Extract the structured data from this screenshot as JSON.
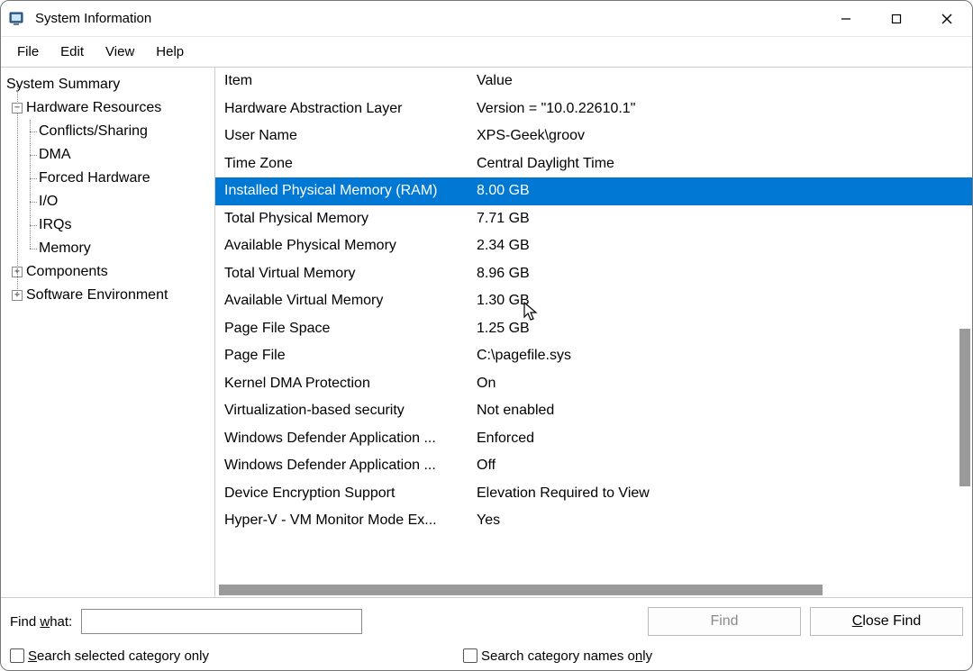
{
  "window": {
    "title": "System Information"
  },
  "menu": {
    "file": "File",
    "edit": "Edit",
    "view": "View",
    "help": "Help"
  },
  "tree": {
    "root": "System Summary",
    "hardware": "Hardware Resources",
    "hw_children": {
      "conflicts": "Conflicts/Sharing",
      "dma": "DMA",
      "forced": "Forced Hardware",
      "io": "I/O",
      "irqs": "IRQs",
      "memory": "Memory"
    },
    "components": "Components",
    "software": "Software Environment"
  },
  "columns": {
    "item": "Item",
    "value": "Value"
  },
  "rows": [
    {
      "item": "Hardware Abstraction Layer",
      "value": "Version = \"10.0.22610.1\""
    },
    {
      "item": "User Name",
      "value": "XPS-Geek\\groov"
    },
    {
      "item": "Time Zone",
      "value": "Central Daylight Time"
    },
    {
      "item": "Installed Physical Memory (RAM)",
      "value": "8.00 GB",
      "selected": true
    },
    {
      "item": "Total Physical Memory",
      "value": "7.71 GB"
    },
    {
      "item": "Available Physical Memory",
      "value": "2.34 GB"
    },
    {
      "item": "Total Virtual Memory",
      "value": "8.96 GB"
    },
    {
      "item": "Available Virtual Memory",
      "value": "1.30 GB"
    },
    {
      "item": "Page File Space",
      "value": "1.25 GB"
    },
    {
      "item": "Page File",
      "value": "C:\\pagefile.sys"
    },
    {
      "item": "Kernel DMA Protection",
      "value": "On"
    },
    {
      "item": "Virtualization-based security",
      "value": "Not enabled"
    },
    {
      "item": "Windows Defender Application ...",
      "value": "Enforced"
    },
    {
      "item": "Windows Defender Application ...",
      "value": "Off"
    },
    {
      "item": "Device Encryption Support",
      "value": "Elevation Required to View"
    },
    {
      "item": "Hyper-V - VM Monitor Mode Ex...",
      "value": "Yes"
    }
  ],
  "partial_row": {
    "item": "",
    "value": ""
  },
  "search": {
    "label_pre": "Find ",
    "label_u": "w",
    "label_post": "hat:",
    "value": "",
    "find_btn": "Find",
    "close_pre": "",
    "close_u": "C",
    "close_post": "lose Find",
    "chk1_pre": "",
    "chk1_u": "S",
    "chk1_post": "earch selected category only",
    "chk2_pre": "Search category names o",
    "chk2_u": "n",
    "chk2_post": "ly"
  }
}
